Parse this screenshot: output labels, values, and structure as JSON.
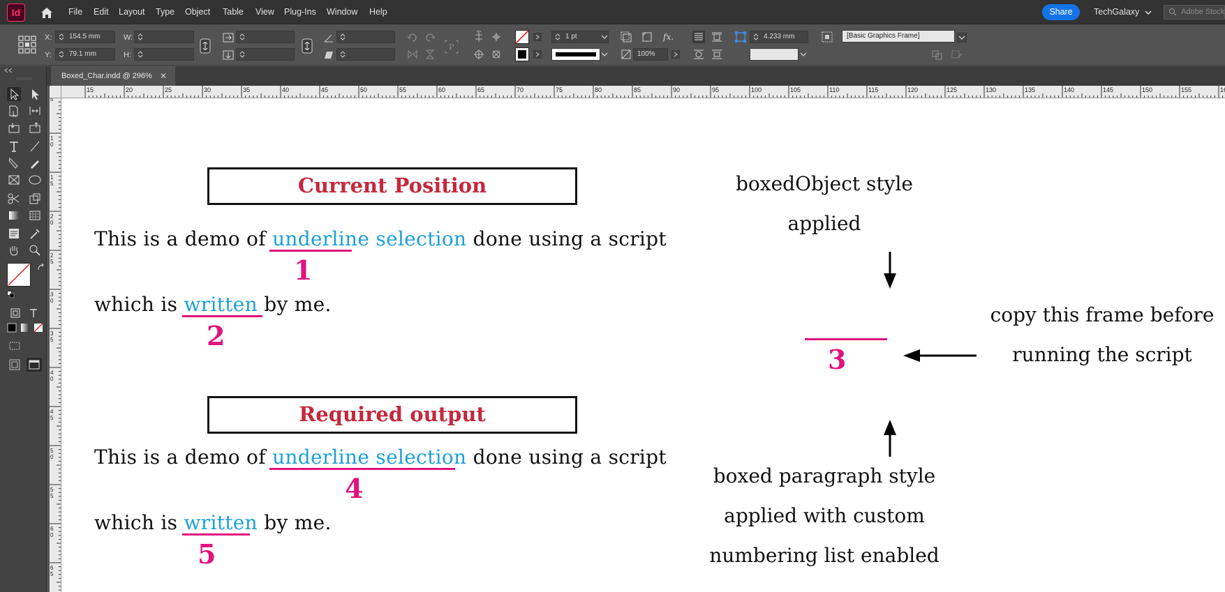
{
  "app": {
    "logo": "Id"
  },
  "menu": [
    "File",
    "Edit",
    "Layout",
    "Type",
    "Object",
    "Table",
    "View",
    "Plug-Ins",
    "Window",
    "Help"
  ],
  "header": {
    "share_label": "Share",
    "workspace": "TechGalaxy",
    "search_placeholder": "Adobe Stock"
  },
  "control_panel": {
    "x_label": "X:",
    "x_value": "154.5 mm",
    "y_label": "Y:",
    "y_value": "79.1 mm",
    "w_label": "W:",
    "h_label": "H:",
    "stroke_weight": "1 pt",
    "opacity": "100%",
    "offset": "4.233 mm",
    "object_style": "[Basic Graphics Frame]"
  },
  "tab": {
    "title": "Boxed_Char.indd @ 296%"
  },
  "ruler": {
    "top_labels": [
      "15",
      "20",
      "25",
      "30",
      "35",
      "40",
      "45",
      "50",
      "55",
      "60",
      "65",
      "70",
      "75",
      "80",
      "85",
      "90",
      "95",
      "100",
      "105",
      "110",
      "115",
      "120",
      "125",
      "130",
      "135",
      "140",
      "145",
      "150",
      "155",
      "160"
    ],
    "left_labels": [
      "5",
      "10",
      "15",
      "20",
      "25",
      "30",
      "35",
      "40",
      "45",
      "50",
      "55",
      "60",
      "65"
    ]
  },
  "document": {
    "current_position_label": "Current Position",
    "required_output_label": "Required output",
    "line1_pre": "This is a demo of ",
    "line1_sel": "underline selection",
    "line1_post": " done using a script",
    "line2_pre": "which is ",
    "line2_sel": "written",
    "line2_post": " by me.",
    "markers": [
      "1",
      "2",
      "3",
      "4",
      "5"
    ],
    "annotation_top": [
      "boxedObject style",
      "applied"
    ],
    "annotation_right": [
      "copy this frame before",
      "running the script"
    ],
    "annotation_bottom": [
      "boxed paragraph style",
      "applied with custom",
      "numbering list enabled"
    ]
  },
  "colors": {
    "accent_magenta": "#e0137f",
    "heading_red": "#c5283d",
    "selection_blue": "#1ba1d8",
    "share_blue": "#1473e6"
  }
}
